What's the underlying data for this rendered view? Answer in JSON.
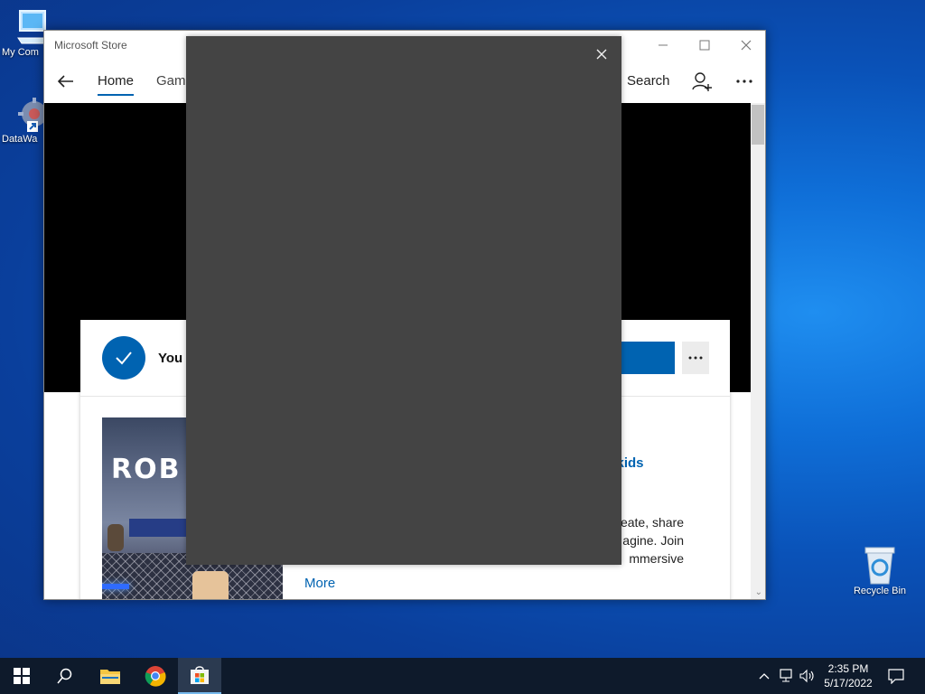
{
  "desktop": {
    "icons": [
      {
        "label": "My Com"
      },
      {
        "label": "DataWa"
      },
      {
        "label": "Recycle Bin"
      }
    ]
  },
  "window": {
    "title": "Microsoft Store",
    "nav": {
      "tabs": [
        {
          "label": "Home"
        },
        {
          "label": "Gami"
        }
      ],
      "search_label": "Search"
    },
    "card": {
      "status_text": "You c",
      "category_link": "y & kids",
      "description": "reate, share\nagine. Join\nmmersive",
      "more_link": "More",
      "game_logo": "ROB"
    }
  },
  "taskbar": {
    "time": "2:35 PM",
    "date": "5/17/2022"
  },
  "colors": {
    "accent": "#0063b1",
    "overlay": "#444444",
    "taskbar": "#0e1a2b"
  }
}
